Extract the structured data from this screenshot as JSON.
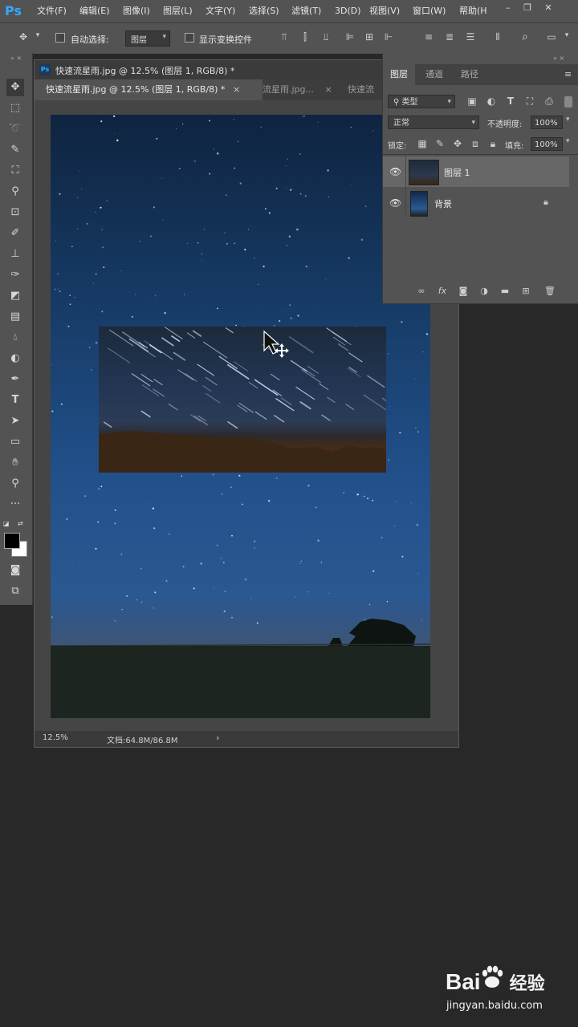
{
  "app": {
    "logo": "Ps",
    "menu": [
      "文件(F)",
      "编辑(E)",
      "图像(I)",
      "图层(L)",
      "文字(Y)",
      "选择(S)",
      "滤镜(T)",
      "3D(D)",
      "视图(V)",
      "窗口(W)",
      "帮助(H"
    ]
  },
  "options_bar": {
    "auto_select_label": "自动选择:",
    "auto_select_value": "图层",
    "show_transform_label": "显示变换控件"
  },
  "document": {
    "title": "快速流星雨.jpg @ 12.5% (图层 1, RGB/8) *",
    "tabs": [
      {
        "label": "快速流星雨.jpg @ 12.5% (图层 1, RGB/8) *",
        "active": true
      },
      {
        "label": "流星雨.jpg...",
        "active": false
      },
      {
        "label": "快速流",
        "active": false
      }
    ],
    "status_zoom": "12.5%",
    "status_doc": "文档:64.8M/86.8M",
    "status_arrow": "›"
  },
  "layers_panel": {
    "tabs": [
      "图层",
      "通道",
      "路径"
    ],
    "filter_kind": "类型",
    "blend_mode": "正常",
    "opacity_label": "不透明度:",
    "opacity_value": "100%",
    "lock_label": "锁定:",
    "fill_label": "填充:",
    "fill_value": "100%",
    "layers": [
      {
        "name": "图层 1",
        "visible": true,
        "selected": true,
        "locked": false
      },
      {
        "name": "背景",
        "visible": true,
        "selected": false,
        "locked": true
      }
    ]
  },
  "watermark": {
    "brand": "Bai",
    "brand2": "经验",
    "url": "jingyan.baidu.com"
  },
  "colors": {
    "accent": "#31a8ff",
    "ui_bg": "#535353",
    "workspace": "#282828"
  }
}
